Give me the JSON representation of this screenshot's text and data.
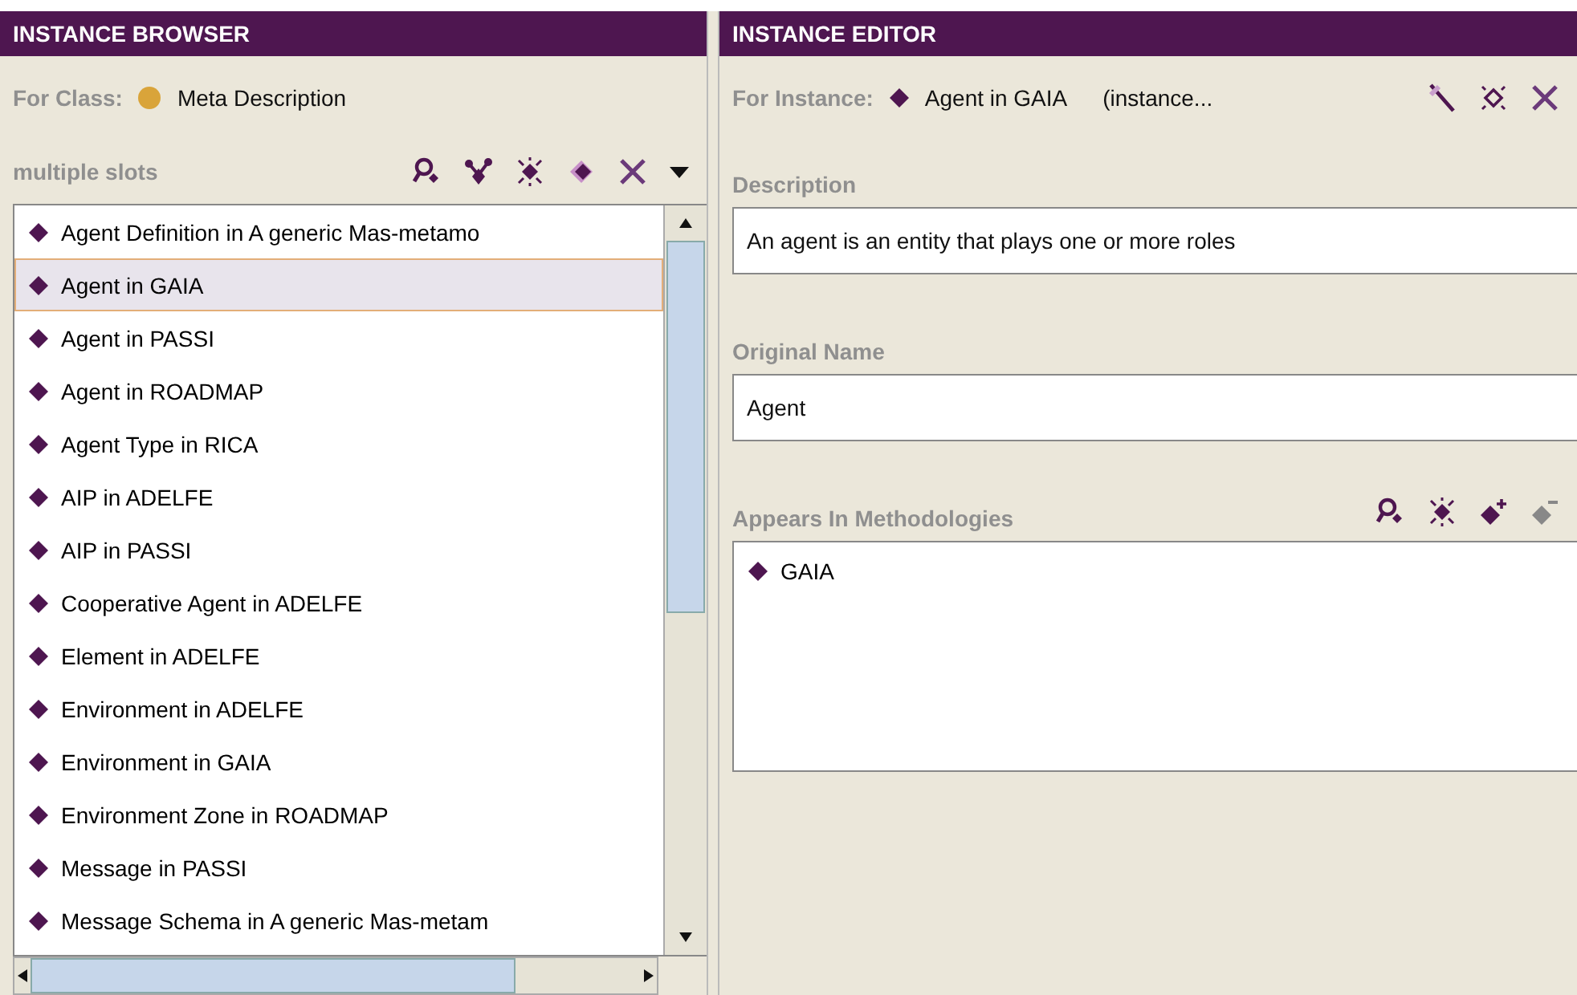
{
  "browser": {
    "title": "INSTANCE BROWSER",
    "class_label": "For Class:",
    "class_name": "Meta Description",
    "slots_label": "multiple slots",
    "tools": [
      {
        "kind": "find"
      },
      {
        "kind": "links"
      },
      {
        "kind": "burst"
      },
      {
        "kind": "diamond"
      },
      {
        "kind": "delete"
      },
      {
        "kind": "menu"
      }
    ],
    "instances": [
      {
        "label": "Agent Definition in A generic Mas-metamo",
        "selected": false
      },
      {
        "label": "Agent in GAIA",
        "selected": true
      },
      {
        "label": "Agent in PASSI",
        "selected": false
      },
      {
        "label": "Agent in ROADMAP",
        "selected": false
      },
      {
        "label": "Agent Type in RICA",
        "selected": false
      },
      {
        "label": "AIP in ADELFE",
        "selected": false
      },
      {
        "label": "AIP in PASSI",
        "selected": false
      },
      {
        "label": "Cooperative Agent in ADELFE",
        "selected": false
      },
      {
        "label": "Element in ADELFE",
        "selected": false
      },
      {
        "label": "Environment in ADELFE",
        "selected": false
      },
      {
        "label": "Environment in GAIA",
        "selected": false
      },
      {
        "label": "Environment Zone in ROADMAP",
        "selected": false
      },
      {
        "label": "Message in PASSI",
        "selected": false
      },
      {
        "label": "Message Schema in A generic Mas-metam",
        "selected": false
      }
    ]
  },
  "editor": {
    "title": "INSTANCE EDITOR",
    "instance_label": "For Instance:",
    "instance_name": "Agent in GAIA",
    "instance_type": "(instance...",
    "tools": [
      {
        "kind": "pin"
      },
      {
        "kind": "burst-outline"
      },
      {
        "kind": "delete"
      }
    ],
    "fields": [
      {
        "label": "Description",
        "value": "An agent is an entity that plays one or more roles"
      },
      {
        "label": "Original Name",
        "value": "Agent"
      }
    ],
    "methodologies": {
      "label": "Appears In Methodologies",
      "tools": [
        {
          "kind": "find"
        },
        {
          "kind": "burst"
        },
        {
          "kind": "add"
        },
        {
          "kind": "remove"
        }
      ],
      "items": [
        "GAIA"
      ]
    }
  }
}
